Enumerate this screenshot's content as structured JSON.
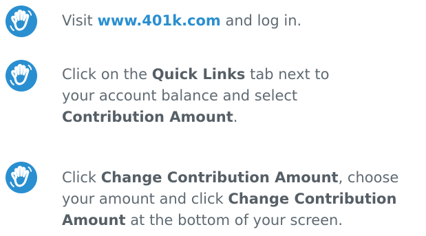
{
  "colors": {
    "icon": "#2a8fd0",
    "link": "#2a8fd0",
    "body_text": "#5f6a72"
  },
  "steps": [
    {
      "icon": "hand-wave-icon",
      "lines": [
        {
          "parts": [
            {
              "t": "Visit "
            },
            {
              "t": "www.401k.com",
              "s": "link"
            },
            {
              "t": " and log in."
            }
          ]
        }
      ]
    },
    {
      "icon": "hand-wave-icon",
      "lines": [
        {
          "parts": [
            {
              "t": "Click on the "
            },
            {
              "t": "Quick Links",
              "s": "strong"
            },
            {
              "t": " tab next to"
            }
          ]
        },
        {
          "parts": [
            {
              "t": "your account balance and select"
            }
          ]
        },
        {
          "parts": [
            {
              "t": "Contribution Amount",
              "s": "strong"
            },
            {
              "t": "."
            }
          ]
        }
      ]
    },
    {
      "icon": "hand-wave-icon",
      "lines": [
        {
          "parts": [
            {
              "t": "Click "
            },
            {
              "t": "Change Contribution Amount",
              "s": "strong"
            },
            {
              "t": ", choose"
            }
          ]
        },
        {
          "parts": [
            {
              "t": "your amount and click "
            },
            {
              "t": "Change Contribution",
              "s": "strong"
            }
          ]
        },
        {
          "parts": [
            {
              "t": "Amount",
              "s": "strong"
            },
            {
              "t": " at the bottom of your screen."
            }
          ]
        }
      ]
    }
  ]
}
